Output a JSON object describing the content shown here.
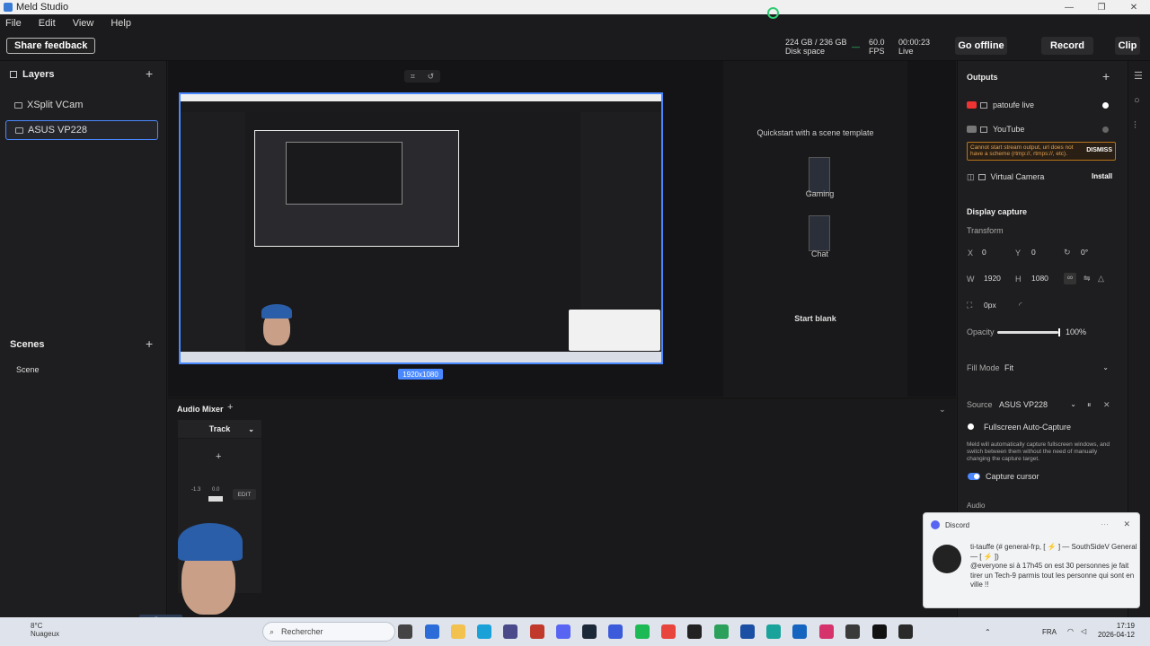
{
  "window": {
    "title": "Meld Studio",
    "controls": [
      "—",
      "❐",
      "✕"
    ]
  },
  "menu": [
    "File",
    "Edit",
    "View",
    "Help"
  ],
  "topbar": {
    "share_feedback": "Share feedback",
    "disk_value": "224 GB / 236 GB",
    "disk_label": "Disk space",
    "fps_value": "60.0",
    "fps_label": "FPS",
    "fps_dash": "—",
    "time_value": "00:00:23",
    "live_label": "Live",
    "go_offline": "Go offline",
    "record": "Record",
    "clip": "Clip"
  },
  "layers": {
    "title": "Layers",
    "add": "+",
    "items": [
      {
        "label": "XSplit VCam",
        "selected": false
      },
      {
        "label": "ASUS VP228",
        "selected": true
      }
    ]
  },
  "scenes": {
    "title": "Scenes",
    "add": "+",
    "items": [
      "Scene"
    ]
  },
  "canvas": {
    "resolution": "1920x1080",
    "tool_crop": "⌗",
    "tool_rotate": "↺"
  },
  "templates": {
    "title": "Quickstart with a scene template",
    "items": [
      "Gaming",
      "Chat"
    ],
    "start_blank": "Start blank"
  },
  "outputs": {
    "title": "Outputs",
    "add": "+",
    "items": [
      {
        "label": "patoufe live",
        "icon": "youtube-icon"
      },
      {
        "label": "YouTube",
        "icon": "youtube-icon"
      },
      {
        "label": "Virtual Camera",
        "icon": "camera-icon"
      }
    ],
    "error_text": "Cannot start stream output, url does not have a scheme (rtmp://, rtmps://, etc).",
    "dismiss": "DISMISS",
    "install": "Install"
  },
  "display_capture": {
    "title": "Display capture",
    "transform_label": "Transform",
    "x_label": "X",
    "x_value": "0",
    "y_label": "Y",
    "y_value": "0",
    "rot_value": "0°",
    "w_label": "W",
    "w_value": "1920",
    "h_label": "H",
    "h_value": "1080",
    "crop_value": "0px",
    "opacity_label": "Opacity",
    "opacity_value": "100%",
    "opacity_fraction": 1.0,
    "fill_mode_label": "Fill Mode",
    "fill_mode_value": "Fit",
    "source_label": "Source",
    "source_value": "ASUS VP228",
    "fullscreen_label": "Fullscreen Auto-Capture",
    "fullscreen_desc": "Meld will automatically capture fullscreen windows, and switch between them without the need of manually changing the capture target.",
    "capture_cursor_label": "Capture cursor",
    "audio_label": "Audio"
  },
  "mixer": {
    "title": "Audio Mixer",
    "add": "+",
    "track_label": "Track",
    "track_add": "+",
    "edit": "EDIT",
    "db_left": "-1.3",
    "db_right": "0.0"
  },
  "discord": {
    "app": "Discord",
    "header": "ti-tauffe (# general-frp, [ ⚡ ] — SouthSideV General — [ ⚡ ])",
    "message": "@everyone si à 17h45 on est 30 personnes je fait tirer un Tech-9 parmis tout les personne qui sont en ville !!",
    "more": "···",
    "close": "✕"
  },
  "webcam_tag": "XSplit VCam",
  "taskbar": {
    "temp": "8°C",
    "weather": "Nuageux",
    "search_placeholder": "Rechercher",
    "lang": "FRA",
    "time": "17:19",
    "date": "2026-04-12"
  }
}
